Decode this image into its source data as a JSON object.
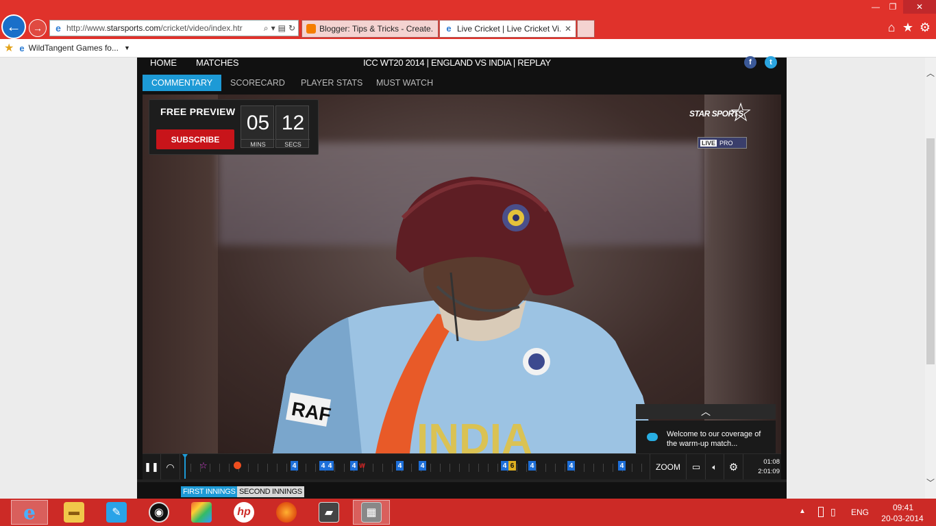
{
  "browser": {
    "url_prefix": "http://www.",
    "url_host": "starsports.com",
    "url_path": "/cricket/video/index.htr",
    "tabs": [
      {
        "label": "Blogger: Tips & Tricks - Create..."
      },
      {
        "label": "Live Cricket | Live Cricket Vi..."
      }
    ],
    "favorites": [
      {
        "label": "WildTangent Games fo..."
      }
    ]
  },
  "site": {
    "nav": {
      "home": "HOME",
      "matches": "MATCHES"
    },
    "match_title": "ICC WT20 2014 | ENGLAND VS INDIA | REPLAY",
    "social": {
      "facebook": "f",
      "twitter": "t"
    },
    "subtabs": [
      "COMMENTARY",
      "SCORECARD",
      "PLAYER STATS",
      "MUST WATCH"
    ]
  },
  "video": {
    "free_preview": "FREE PREVIEW",
    "subscribe": "SUBSCRIBE",
    "timer": {
      "mins": "05",
      "mins_label": "MINS",
      "secs": "12",
      "secs_label": "SECS"
    },
    "logo_text": "STAR SPORTS",
    "badge_live": "LIVE",
    "badge_pro": "PRO",
    "commentary_text": "Welcome to our coverage of the warm-up match...",
    "jersey_text": "INDIA",
    "sleeve_text": "RAF"
  },
  "controls": {
    "zoom": "ZOOM",
    "time_current": "01:08",
    "time_total": "2:01:09",
    "timeline_markers": [
      {
        "type": "star",
        "label": "☆",
        "pos": 0.04
      },
      {
        "type": "dot",
        "label": "",
        "pos": 0.115
      },
      {
        "type": "four",
        "label": "4",
        "pos": 0.238
      },
      {
        "type": "four",
        "label": "4",
        "pos": 0.3
      },
      {
        "type": "four",
        "label": "4",
        "pos": 0.316
      },
      {
        "type": "four",
        "label": "4",
        "pos": 0.367
      },
      {
        "type": "wicket",
        "label": "W",
        "pos": 0.385
      },
      {
        "type": "four",
        "label": "4",
        "pos": 0.468
      },
      {
        "type": "four",
        "label": "4",
        "pos": 0.517
      },
      {
        "type": "four",
        "label": "4",
        "pos": 0.695
      },
      {
        "type": "six",
        "label": "6",
        "pos": 0.711
      },
      {
        "type": "four",
        "label": "4",
        "pos": 0.754
      },
      {
        "type": "four",
        "label": "4",
        "pos": 0.839
      },
      {
        "type": "four",
        "label": "4",
        "pos": 0.95
      }
    ]
  },
  "innings": {
    "first": "FIRST INNINGS",
    "second": "SECOND INNINGS"
  },
  "taskbar": {
    "lang": "ENG",
    "time": "09:41",
    "date": "20-03-2014",
    "hp_label": "hp"
  },
  "colors": {
    "chrome_red": "#e0322b",
    "accent_blue": "#1d9ad6",
    "subscribe_red": "#c8141a"
  }
}
